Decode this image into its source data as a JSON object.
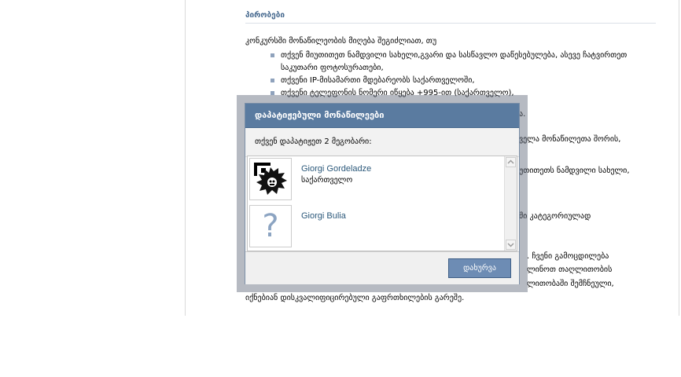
{
  "page": {
    "section_title": "პირობები",
    "intro": "კონკურსში მონაწილეობის მიღება შეგიძლიათ, თუ",
    "rules": [
      "თქვენ მიუთითეთ ნამდვილი სახელი,გვარი და სასწავლო დაწესებულება, ასევე ჩატვირთეთ საკუთარი ფოტოსურათები,",
      "თქვენი IP-მისამართი მდებარეობს საქართველოში,",
      "თქვენი ტელეფონის ნომერი იწყება +995-ით (საქართველო),"
    ],
    "background_lines": [
      "ა.",
      "ველა მონაწილეთა შორის,",
      "უთითეთს ნამდვილი სახელი,",
      "ში კატეგორიულად",
      ". ჩვენი გამოცდილება",
      "ლინოთ თაღლითობის",
      "ლითობაში შემჩნეული,",
      "იქნებიან დისკვალიფიცირებული გაფრთხილების გარეშე."
    ]
  },
  "dialog": {
    "title": "დაპატიჟებული მონაწილეები",
    "subtitle": "თქვენ დაპატიჟეთ 2 მეგობარი:",
    "friends": [
      {
        "name": "Giorgi Gordeladze",
        "country": "საქართველო"
      },
      {
        "name": "Giorgi Bulia",
        "country": ""
      }
    ],
    "close_label": "დახურვა",
    "placeholder_glyph": "?"
  }
}
